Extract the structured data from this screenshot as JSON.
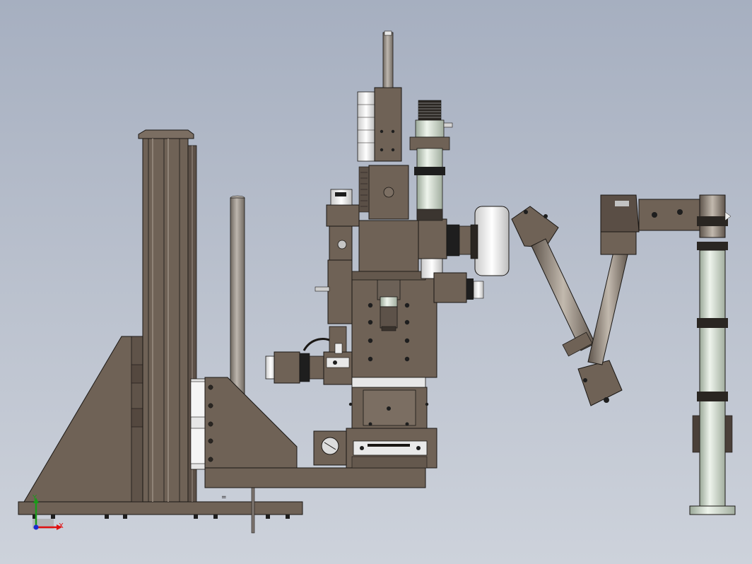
{
  "viewport": {
    "background_top": "#a6afc0",
    "background_bottom": "#cdd2db"
  },
  "colors": {
    "body": "#6f6256",
    "body_dark": "#54483f",
    "body_light": "#837567",
    "outline": "#1a1714",
    "rod": "#a59e98",
    "column_highlight": "#8f8377",
    "glass": "#dfe8dc",
    "glass_shade": "#b6c2b2",
    "white_part": "#f2f2f2",
    "black_ring": "#1e1e1e",
    "arm_metal": "#7b7066",
    "arm_light": "#b0a79d",
    "axis_x": "#e01010",
    "axis_y": "#1a9a1a",
    "axis_z": "#1a2ad0"
  },
  "triad": {
    "x_label": "X",
    "y_label": "Y"
  },
  "components": [
    "base-plate",
    "vertical-column",
    "triangular-gusset",
    "support-rod",
    "xy-stage",
    "microscope-head",
    "objective-lens",
    "stepper-motor",
    "camera-tube",
    "articulated-arm",
    "floor-stand"
  ]
}
